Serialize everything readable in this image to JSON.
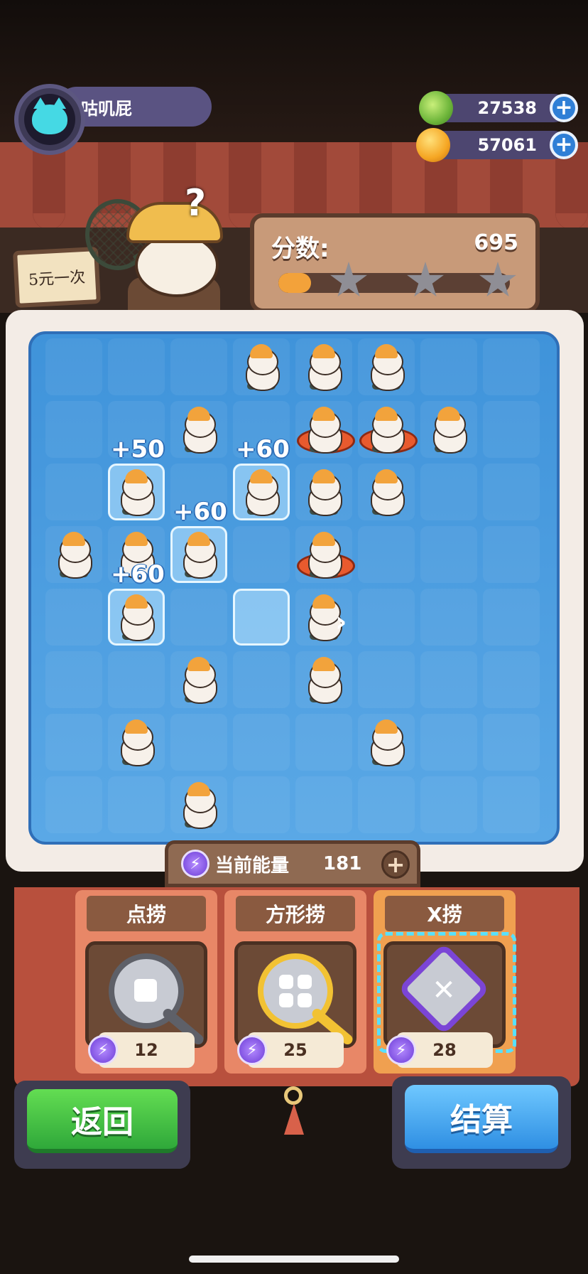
{
  "player": {
    "name": "咕叽屁",
    "avatar_icon": "cat-avatar-icon"
  },
  "currencies": [
    {
      "name": "green-coin",
      "value": "27538",
      "color": "#6db53a"
    },
    {
      "name": "planet-coin",
      "value": "57061",
      "color": "#f5a623"
    }
  ],
  "shop_sign": {
    "text": "5元一次"
  },
  "character": {
    "thought": "?"
  },
  "score": {
    "label": "分数:",
    "value": "695",
    "progress": 0.14,
    "stars_total": 3,
    "stars_earned": 0
  },
  "board": {
    "rows": 8,
    "cols": 8,
    "otters": [
      {
        "r": 0,
        "c": 3
      },
      {
        "r": 0,
        "c": 4
      },
      {
        "r": 0,
        "c": 5
      },
      {
        "r": 1,
        "c": 2
      },
      {
        "r": 1,
        "c": 4,
        "ring": true
      },
      {
        "r": 1,
        "c": 5,
        "ring": true
      },
      {
        "r": 1,
        "c": 6
      },
      {
        "r": 2,
        "c": 1
      },
      {
        "r": 2,
        "c": 3
      },
      {
        "r": 2,
        "c": 4
      },
      {
        "r": 2,
        "c": 5
      },
      {
        "r": 3,
        "c": 0
      },
      {
        "r": 3,
        "c": 1
      },
      {
        "r": 3,
        "c": 2
      },
      {
        "r": 3,
        "c": 4,
        "ring": true
      },
      {
        "r": 4,
        "c": 1
      },
      {
        "r": 4,
        "c": 4
      },
      {
        "r": 5,
        "c": 2
      },
      {
        "r": 5,
        "c": 4
      },
      {
        "r": 6,
        "c": 1
      },
      {
        "r": 6,
        "c": 5
      },
      {
        "r": 7,
        "c": 2
      }
    ],
    "selected_cells": [
      {
        "r": 2,
        "c": 1
      },
      {
        "r": 2,
        "c": 3
      },
      {
        "r": 3,
        "c": 2
      },
      {
        "r": 4,
        "c": 1
      },
      {
        "r": 4,
        "c": 3
      }
    ],
    "score_popups": [
      {
        "text": "+50",
        "r": 2,
        "c": 1
      },
      {
        "text": "+60",
        "r": 2,
        "c": 3
      },
      {
        "text": "+60",
        "r": 3,
        "c": 2
      },
      {
        "text": "+60",
        "r": 4,
        "c": 1
      }
    ]
  },
  "energy": {
    "label": "当前能量",
    "value": "181"
  },
  "tools": [
    {
      "name": "点捞",
      "cost": "12",
      "icon": "magnifier-dot-icon",
      "active": false
    },
    {
      "name": "方形捞",
      "cost": "25",
      "icon": "magnifier-square-icon",
      "active": false
    },
    {
      "name": "X捞",
      "cost": "28",
      "icon": "diamond-x-icon",
      "active": true
    }
  ],
  "buttons": {
    "back": "返回",
    "settle": "结算"
  },
  "colors": {
    "accent_green": "#2fa83a",
    "accent_blue": "#2f8fe3",
    "energy_purple": "#6b3bd6"
  }
}
